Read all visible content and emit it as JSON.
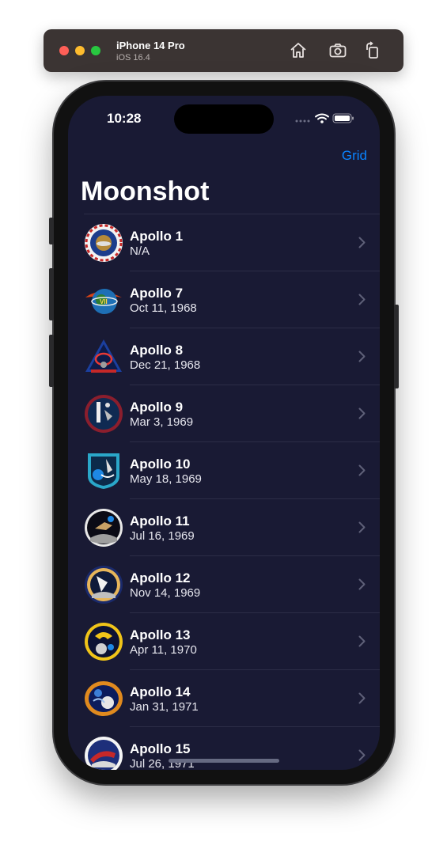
{
  "simulator": {
    "device": "iPhone 14 Pro",
    "os": "iOS 16.4",
    "buttons": [
      "home-icon",
      "screenshot-icon",
      "rotate-icon"
    ]
  },
  "status_bar": {
    "time": "10:28"
  },
  "nav": {
    "grid_label": "Grid",
    "title": "Moonshot"
  },
  "missions": [
    {
      "name": "Apollo 1",
      "date": "N/A",
      "badge": "apollo-1-patch"
    },
    {
      "name": "Apollo 7",
      "date": "Oct 11, 1968",
      "badge": "apollo-7-patch"
    },
    {
      "name": "Apollo 8",
      "date": "Dec 21, 1968",
      "badge": "apollo-8-patch"
    },
    {
      "name": "Apollo 9",
      "date": "Mar 3, 1969",
      "badge": "apollo-9-patch"
    },
    {
      "name": "Apollo 10",
      "date": "May 18, 1969",
      "badge": "apollo-10-patch"
    },
    {
      "name": "Apollo 11",
      "date": "Jul 16, 1969",
      "badge": "apollo-11-patch"
    },
    {
      "name": "Apollo 12",
      "date": "Nov 14, 1969",
      "badge": "apollo-12-patch"
    },
    {
      "name": "Apollo 13",
      "date": "Apr 11, 1970",
      "badge": "apollo-13-patch"
    },
    {
      "name": "Apollo 14",
      "date": "Jan 31, 1971",
      "badge": "apollo-14-patch"
    },
    {
      "name": "Apollo 15",
      "date": "Jul 26, 1971",
      "badge": "apollo-15-patch"
    }
  ],
  "colors": {
    "background": "#191a34",
    "accent": "#0a84ff"
  }
}
